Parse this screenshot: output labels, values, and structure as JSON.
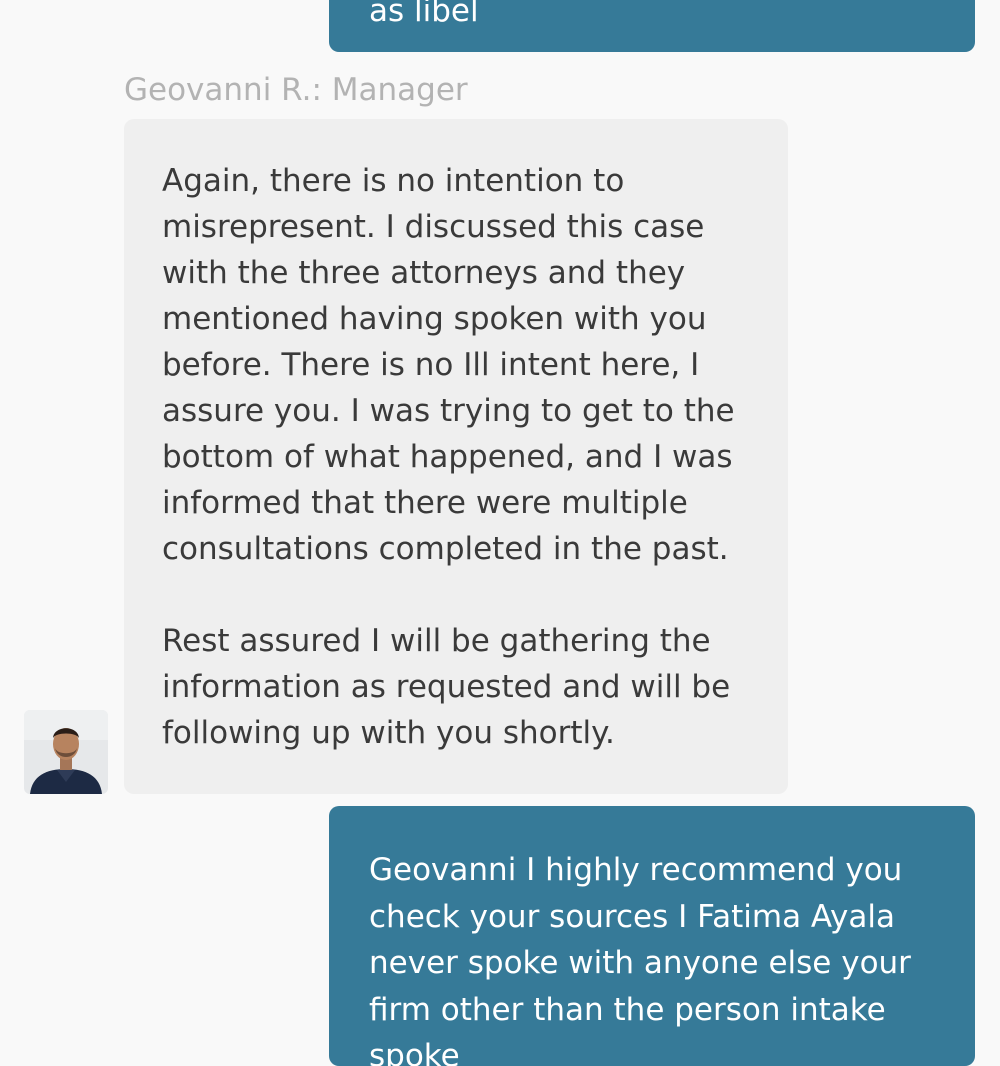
{
  "conversation": {
    "top_outgoing": {
      "text": "as libel"
    },
    "incoming": {
      "sender_label": "Geovanni R.: Manager",
      "paragraphs": [
        "Again, there is no intention to misrepresent. I discussed this case with the three attorneys and they mentioned having spoken with you before. There is no Ill intent here, I assure you. I was trying to get to the bottom of what happened, and I was informed that there were multiple consultations completed in the past.",
        "Rest assured I will be gathering the information as requested and will be following up with you shortly."
      ]
    },
    "bottom_outgoing": {
      "text": "Geovanni I highly recommend you check your sources I Fatima Ayala never spoke with anyone else your firm other than the person intake spoke"
    }
  },
  "colors": {
    "outgoing_bubble": "#367a98",
    "incoming_bubble": "#efefef",
    "background": "#f9f9f9"
  }
}
